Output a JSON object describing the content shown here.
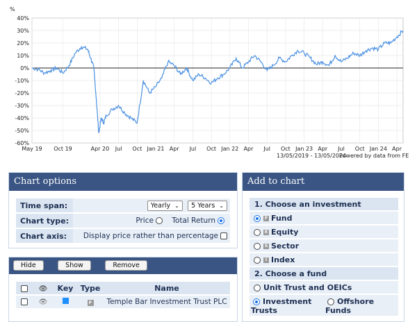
{
  "chart_data": {
    "type": "line",
    "ylabel": "%",
    "ylim": [
      -60,
      40
    ],
    "yticks": [
      "40%",
      "30%",
      "20%",
      "10%",
      "0%",
      "-10%",
      "-20%",
      "-30%",
      "-40%",
      "-50%",
      "-60%"
    ],
    "xticks": [
      "May 19",
      "Oct 19",
      "Apr 20",
      "Jul",
      "Oct",
      "Jan 21",
      "Apr",
      "Jul",
      "Oct",
      "Jan 22",
      "Apr",
      "Jul",
      "Oct",
      "Jan 23",
      "Apr",
      "Jul",
      "Oct",
      "Jan 24",
      "Apr"
    ],
    "xtick_months": [
      0,
      5,
      11,
      14,
      17,
      20,
      23,
      26,
      29,
      32,
      35,
      38,
      41,
      44,
      47,
      50,
      53,
      56,
      59
    ],
    "x_months": [
      0,
      1,
      2,
      3,
      4,
      5,
      6,
      7,
      8,
      9,
      9.5,
      10,
      10.4,
      10.8,
      11.2,
      11.6,
      12,
      13,
      14,
      15,
      16,
      17,
      18,
      19,
      20,
      21,
      22,
      23,
      24,
      25,
      26,
      27,
      28,
      29,
      30,
      31,
      32,
      33,
      34,
      35,
      36,
      37,
      38,
      39,
      40,
      41,
      42,
      43,
      44,
      45,
      46,
      47,
      48,
      49,
      50,
      51,
      52,
      53,
      54,
      55,
      56,
      57,
      58,
      59,
      60
    ],
    "series": [
      {
        "values": [
          0,
          -1,
          -4,
          -2,
          0,
          -4,
          2,
          12,
          17,
          15,
          8,
          0,
          -25,
          -52,
          -40,
          -44,
          -38,
          -33,
          -30,
          -36,
          -40,
          -44,
          -10,
          -20,
          -15,
          -8,
          5,
          2,
          -5,
          0,
          -10,
          -5,
          -8,
          -12,
          -8,
          -5,
          0,
          8,
          0,
          5,
          10,
          5,
          -2,
          2,
          8,
          5,
          10,
          14,
          12,
          8,
          3,
          5,
          2,
          10,
          5,
          8,
          12,
          10,
          14,
          16,
          15,
          20,
          20,
          25,
          30
        ]
      }
    ],
    "caption": "13/05/2019 - 13/05/2024",
    "credit": "Powered by data from FE"
  },
  "chart_options": {
    "title": "Chart options",
    "time_span_label": "Time span:",
    "time_span_interval": "Yearly",
    "time_span_period": "5 Years",
    "chart_type_label": "Chart type:",
    "chart_type_price": "Price",
    "chart_type_total_return": "Total Return",
    "chart_type_selected": "Total Return",
    "chart_axis_label": "Chart axis:",
    "chart_axis_text": "Display price rather than percentage"
  },
  "fund_list": {
    "hide_label": "Hide",
    "show_label": "Show",
    "remove_label": "Remove",
    "columns": [
      "Key",
      "Type",
      "Name"
    ],
    "rows": [
      {
        "type_badge": "F",
        "name": "Temple Bar Investment Trust PLC",
        "key_color": "#1e90ff"
      }
    ]
  },
  "add_to_chart": {
    "title": "Add to chart",
    "step1_label": "1. Choose an investment",
    "investments": [
      {
        "badge": "F",
        "label": "Fund",
        "selected": true
      },
      {
        "badge": "E",
        "label": "Equity",
        "selected": false
      },
      {
        "badge": "S",
        "label": "Sector",
        "selected": false
      },
      {
        "badge": "I",
        "label": "Index",
        "selected": false
      }
    ],
    "step2_label": "2. Choose a fund",
    "fund_types": [
      {
        "label": "Unit Trust and OEICs",
        "selected": false
      },
      {
        "label": "Investment Trusts",
        "selected": true
      },
      {
        "label": "Offshore Funds",
        "selected": false
      }
    ]
  },
  "colors": {
    "header": "#3a5584",
    "line": "#4a90e2",
    "key": "#1e90ff"
  }
}
